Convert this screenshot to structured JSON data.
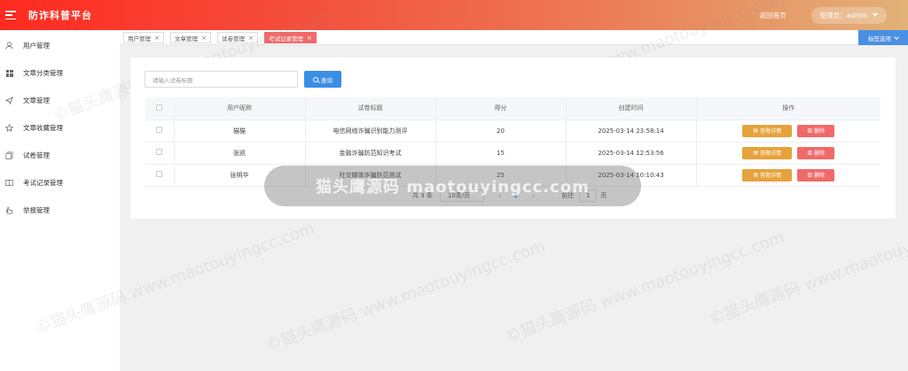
{
  "header": {
    "title": "防诈科普平台",
    "home_link": "返回首页",
    "admin_label": "管理员：admin"
  },
  "sidebar": {
    "items": [
      {
        "label": "用户管理",
        "icon": "user-icon"
      },
      {
        "label": "文章分类管理",
        "icon": "grid-icon"
      },
      {
        "label": "文章管理",
        "icon": "send-icon"
      },
      {
        "label": "文章收藏管理",
        "icon": "star-icon"
      },
      {
        "label": "试卷管理",
        "icon": "copy-icon"
      },
      {
        "label": "考试记录管理",
        "icon": "book-icon"
      },
      {
        "label": "举报管理",
        "icon": "hand-icon"
      }
    ]
  },
  "tabs": [
    {
      "label": "用户管理"
    },
    {
      "label": "文章管理"
    },
    {
      "label": "试卷管理"
    },
    {
      "label": "考试记录管理"
    }
  ],
  "tab_options": "标签选项",
  "search": {
    "placeholder": "请输入试卷标题",
    "button": "查询"
  },
  "table": {
    "headers": [
      "用户昵称",
      "试卷标题",
      "得分",
      "创建时间",
      "操作"
    ],
    "rows": [
      {
        "nickname": "猫猫",
        "title": "电信网络诈骗识别能力测评",
        "score": "20",
        "created": "2025-03-14 23:58:14"
      },
      {
        "nickname": "张凯",
        "title": "金融诈骗防范知识考试",
        "score": "15",
        "created": "2025-03-14 12:53:56"
      },
      {
        "nickname": "张明华",
        "title": "社交媒体诈骗防范测试",
        "score": "25",
        "created": "2025-03-14 10:10:43"
      }
    ],
    "detail_button": "答题详情",
    "delete_button": "删除"
  },
  "pagination": {
    "total": "共 3 条",
    "page_size": "10条/页",
    "current_page": "1",
    "goto_label": "前往",
    "goto_value": "1",
    "page_unit": "页"
  },
  "watermark": {
    "center_text": "猫头鹰源码 maotouyingcc.com",
    "tile_text": "©猫头鹰源码 www.maotouyingcc.com"
  },
  "colors": {
    "header_start": "#ff2a20",
    "header_end": "#e2b278",
    "active_tab": "#f06a6a",
    "primary": "#3a8ee6",
    "warning": "#e6a23c",
    "danger": "#f06a6a"
  }
}
